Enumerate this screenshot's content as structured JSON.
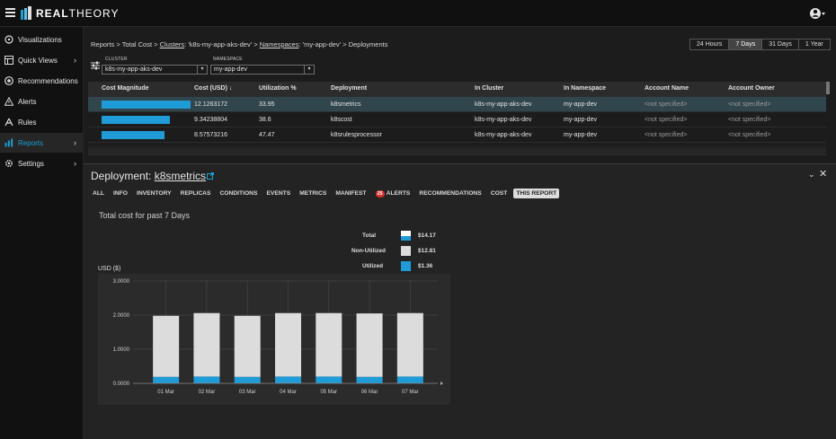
{
  "app": {
    "brand_bold": "REAL",
    "brand_light": "THEORY"
  },
  "sidebar": {
    "items": [
      {
        "label": "Visualizations",
        "icon": "visualizations-icon",
        "chevron": false,
        "active": false
      },
      {
        "label": "Quick Views",
        "icon": "quick-views-icon",
        "chevron": true,
        "active": false
      },
      {
        "label": "Recommendations",
        "icon": "recommendations-icon",
        "chevron": false,
        "active": false
      },
      {
        "label": "Alerts",
        "icon": "alerts-icon",
        "chevron": false,
        "active": false
      },
      {
        "label": "Rules",
        "icon": "rules-icon",
        "chevron": false,
        "active": false
      },
      {
        "label": "Reports",
        "icon": "reports-icon",
        "chevron": true,
        "active": true
      },
      {
        "label": "Settings",
        "icon": "settings-icon",
        "chevron": true,
        "active": false
      }
    ]
  },
  "breadcrumb": {
    "reports": "Reports",
    "sep": ">",
    "total_cost": "Total Cost",
    "clusters_link": "Clusters",
    "cluster_val": ": 'k8s-my-app-aks-dev'",
    "namespaces_link": "Namespaces",
    "namespace_val": ": 'my-app-dev'",
    "deployments": "Deployments"
  },
  "timerange": {
    "options": [
      "24 Hours",
      "7 Days",
      "31 Days",
      "1 Year"
    ],
    "selected": "7 Days"
  },
  "filters": {
    "cluster_label": "CLUSTER",
    "cluster_value": "k8s-my-app-aks-dev",
    "namespace_label": "NAMESPACE",
    "namespace_value": "my-app-dev"
  },
  "table": {
    "headers": {
      "magnitude": "Cost Magnitude",
      "cost": "Cost (USD) ↓",
      "util": "Utilization %",
      "deployment": "Deployment",
      "cluster": "In Cluster",
      "namespace": "In Namespace",
      "account_name": "Account Name",
      "account_owner": "Account Owner"
    },
    "rows": [
      {
        "magnitude": 1.0,
        "cost": "12.1263172",
        "util": "33.95",
        "deployment": "k8smetrics",
        "cluster": "k8s-my-app-aks-dev",
        "namespace": "my-app-dev",
        "account_name": "<not specified>",
        "account_owner": "<not specified>",
        "selected": true
      },
      {
        "magnitude": 0.77,
        "cost": "9.34238804",
        "util": "38.6",
        "deployment": "k8scost",
        "cluster": "k8s-my-app-aks-dev",
        "namespace": "my-app-dev",
        "account_name": "<not specified>",
        "account_owner": "<not specified>",
        "selected": false
      },
      {
        "magnitude": 0.71,
        "cost": "8.57573216",
        "util": "47.47",
        "deployment": "k8srulesprocessor",
        "cluster": "k8s-my-app-aks-dev",
        "namespace": "my-app-dev",
        "account_name": "<not specified>",
        "account_owner": "<not specified>",
        "selected": false
      }
    ]
  },
  "panel": {
    "title_prefix": "Deployment:",
    "deployment_name": "k8smetrics",
    "tabs": [
      {
        "label": "ALL"
      },
      {
        "label": "INFO"
      },
      {
        "label": "INVENTORY"
      },
      {
        "label": "REPLICAS"
      },
      {
        "label": "CONDITIONS"
      },
      {
        "label": "EVENTS"
      },
      {
        "label": "METRICS"
      },
      {
        "label": "MANIFEST"
      },
      {
        "label": "ALERTS",
        "badge": "25"
      },
      {
        "label": "RECOMMENDATIONS"
      },
      {
        "label": "COST"
      },
      {
        "label": "THIS REPORT",
        "selected": true
      }
    ],
    "chart_title": "Total cost for past 7 Days",
    "legend": [
      {
        "label": "Total",
        "value": "$14.17"
      },
      {
        "label": "Non-Utilized",
        "value": "$12.81"
      },
      {
        "label": "Utilized",
        "value": "$1.36"
      }
    ]
  },
  "colors": {
    "accent": "#1a9fd5",
    "utilized": "#1f9bd7",
    "non_utilized": "#dcdcdc",
    "selected_row": "#31454d"
  },
  "chart_data": {
    "type": "bar",
    "stacked": true,
    "ylabel": "USD ($)",
    "categories": [
      "01 Mar",
      "02 Mar",
      "03 Mar",
      "04 Mar",
      "05 Mar",
      "06 Mar",
      "07 Mar"
    ],
    "series": [
      {
        "name": "Utilized",
        "values": [
          0.19,
          0.2,
          0.19,
          0.2,
          0.2,
          0.19,
          0.2
        ]
      },
      {
        "name": "Non-Utilized",
        "values": [
          1.79,
          1.86,
          1.79,
          1.86,
          1.86,
          1.86,
          1.86
        ]
      }
    ],
    "ylim": [
      0,
      3
    ],
    "yticks": [
      "0.0000",
      "1.0000",
      "2.0000",
      "3.0000"
    ],
    "grid": true
  }
}
